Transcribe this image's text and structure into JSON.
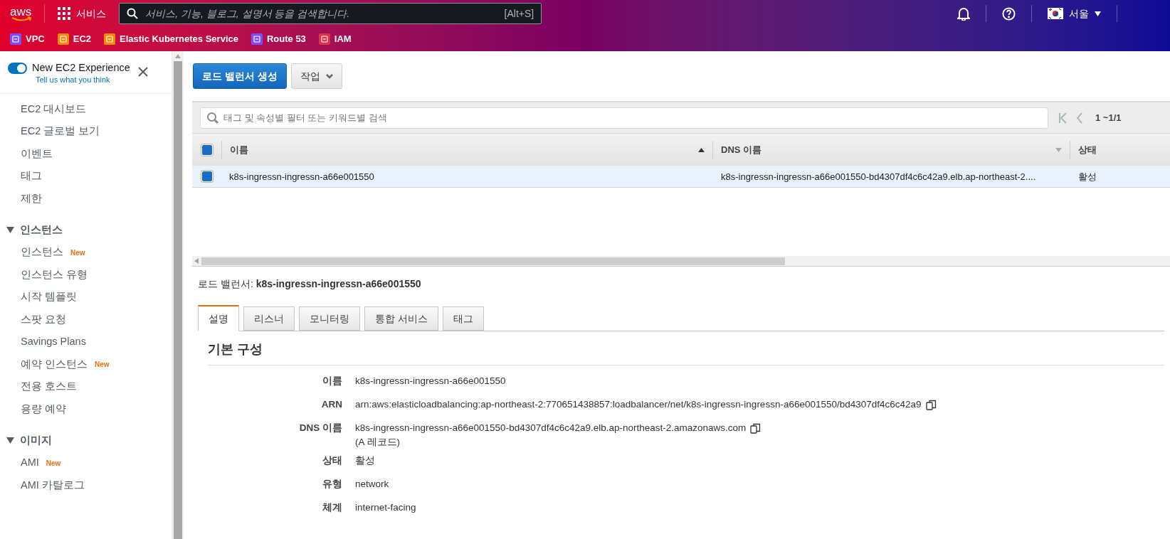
{
  "header": {
    "logo": "aws",
    "services_label": "서비스",
    "search": {
      "placeholder": "서비스, 기능, 블로그, 설명서 등을 검색합니다.",
      "shortcut": "[Alt+S]"
    },
    "region": "서울"
  },
  "favorites": [
    {
      "label": "VPC",
      "color": "#7b4dff"
    },
    {
      "label": "EC2",
      "color": "#f58a07"
    },
    {
      "label": "Elastic Kubernetes Service",
      "color": "#f58a07"
    },
    {
      "label": "Route 53",
      "color": "#7b4dff"
    },
    {
      "label": "IAM",
      "color": "#dd344c"
    }
  ],
  "sidebar": {
    "experience": {
      "on": true,
      "title": "New EC2 Experience",
      "link": "Tell us what you think"
    },
    "items": [
      {
        "kind": "link",
        "label": "EC2 대시보드"
      },
      {
        "kind": "link",
        "label": "EC2 글로벌 보기"
      },
      {
        "kind": "link",
        "label": "이벤트"
      },
      {
        "kind": "link",
        "label": "태그"
      },
      {
        "kind": "link",
        "label": "제한"
      },
      {
        "kind": "section",
        "label": "인스턴스",
        "expanded": true,
        "children": [
          {
            "kind": "link",
            "label": "인스턴스",
            "badge": "New"
          },
          {
            "kind": "link",
            "label": "인스턴스 유형"
          },
          {
            "kind": "link",
            "label": "시작 템플릿"
          },
          {
            "kind": "link",
            "label": "스팟 요청"
          },
          {
            "kind": "link",
            "label": "Savings Plans"
          },
          {
            "kind": "link",
            "label": "예약 인스턴스",
            "badge": "New"
          },
          {
            "kind": "link",
            "label": "전용 호스트"
          },
          {
            "kind": "link",
            "label": "용량 예약"
          }
        ]
      },
      {
        "kind": "section",
        "label": "이미지",
        "expanded": true,
        "children": [
          {
            "kind": "link",
            "label": "AMI",
            "badge": "New"
          },
          {
            "kind": "link",
            "label": "AMI 카탈로그"
          }
        ]
      }
    ]
  },
  "toolbar": [
    {
      "kind": "primary",
      "label": "로드 밸런서 생성"
    },
    {
      "kind": "dropdown",
      "label": "작업"
    }
  ],
  "filter": {
    "placeholder": "태그 및 속성별 필터 또는 키워드별 검색",
    "pagination": "1 ~1/1"
  },
  "table": {
    "header_checked": true,
    "columns": [
      {
        "label": "이름",
        "sortable": true,
        "sorted": true
      },
      {
        "label": "DNS 이름",
        "sortable": true,
        "sorted": false
      },
      {
        "label": "상태",
        "sortable": false
      }
    ],
    "rows": [
      {
        "selected": true,
        "checked": true,
        "cells": [
          "k8s-ingressn-ingressn-a66e001550",
          "k8s-ingressn-ingressn-a66e001550-bd4307df4c6c42a9.elb.ap-northeast-2....",
          "활성"
        ]
      }
    ]
  },
  "detail": {
    "title": "로드 밸런서: **k8s-ingressn-ingressn-a66e001550**",
    "tabs": [
      {
        "label": "설명",
        "selected": true
      },
      {
        "label": "리스너",
        "selected": false
      },
      {
        "label": "모니터링",
        "selected": false
      },
      {
        "label": "통합 서비스",
        "selected": false
      },
      {
        "label": "태그",
        "selected": false
      }
    ],
    "section_title": "기본 구성",
    "fields": [
      {
        "label": "이름",
        "value": "k8s-ingressn-ingressn-a66e001550",
        "copyable": false
      },
      {
        "label": "ARN",
        "value": "arn:aws:elasticloadbalancing:ap-northeast-2:770651438857:loadbalancer/net/k8s-ingressn-ingressn-a66e001550/bd4307df4c6c42a9",
        "copyable": true
      },
      {
        "label": "DNS 이름",
        "value": "k8s-ingressn-ingressn-a66e001550-bd4307df4c6c42a9.elb.ap-northeast-2.amazonaws.com",
        "note": "(A 레코드)",
        "copyable": true
      },
      {
        "label": "상태",
        "value": "활성",
        "copyable": false
      },
      {
        "label": "유형",
        "value": "network",
        "copyable": false
      },
      {
        "label": "체계",
        "value": "internet-facing",
        "copyable": false
      }
    ]
  }
}
